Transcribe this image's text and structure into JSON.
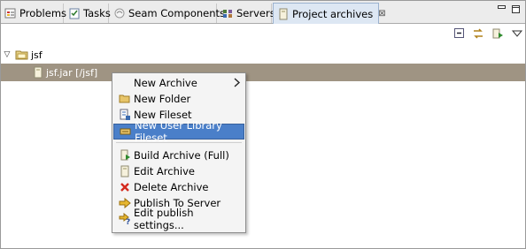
{
  "tabs": [
    {
      "label": "Problems",
      "icon": "problems-icon"
    },
    {
      "label": "Tasks",
      "icon": "tasks-icon"
    },
    {
      "label": "Seam Components",
      "icon": "seam-components-icon"
    },
    {
      "label": "Servers",
      "icon": "servers-icon"
    },
    {
      "label": "Project archives",
      "icon": "project-archives-icon",
      "active": true,
      "close": "⊠"
    }
  ],
  "window_controls": {
    "minimize": "minimize-icon",
    "maximize": "maximize-icon"
  },
  "toolbar": {
    "icons": [
      "collapse-all-icon",
      "link-with-editor-icon",
      "build-icon",
      "view-menu-icon"
    ]
  },
  "tree": {
    "root": {
      "label": "jsf",
      "expanded": true,
      "icon": "project-folder-icon"
    },
    "child": {
      "label": "jsf.jar [/jsf]",
      "icon": "jar-icon",
      "selected": true
    }
  },
  "context_menu": {
    "items": [
      {
        "label": "New Archive",
        "icon": "",
        "submenu": true
      },
      {
        "label": "New Folder",
        "icon": "folder-icon"
      },
      {
        "label": "New Fileset",
        "icon": "fileset-icon"
      },
      {
        "label": "New User Library Fileset",
        "icon": "library-fileset-icon",
        "highlighted": true
      },
      {
        "label": "Build Archive (Full)",
        "icon": "build-archive-icon"
      },
      {
        "label": "Edit Archive",
        "icon": "edit-archive-icon"
      },
      {
        "label": "Delete Archive",
        "icon": "delete-icon"
      },
      {
        "label": "Publish To Server",
        "icon": "publish-icon"
      },
      {
        "label": "Edit publish settings...",
        "icon": "publish-settings-icon"
      }
    ]
  },
  "colors": {
    "selection": "#9f9483",
    "menu_highlight": "#4a7fc9",
    "active_tab": "#dde7f3"
  }
}
